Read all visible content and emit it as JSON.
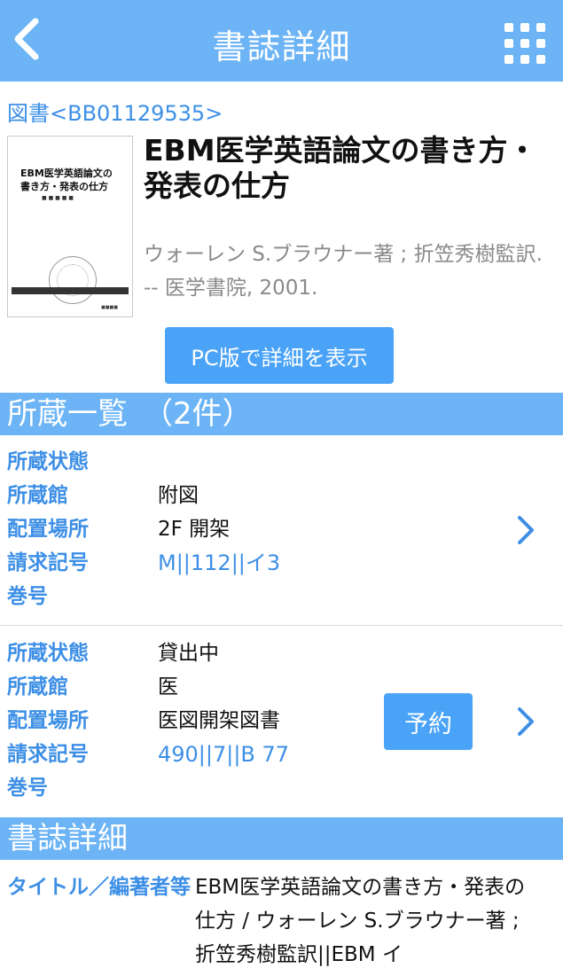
{
  "header": {
    "title": "書誌詳細"
  },
  "bib_id": "図書<BB01129535>",
  "book": {
    "cover_lines": [
      "EBM医学英語論文の",
      "書き方・発表の仕方"
    ],
    "title": "EBM医学英語論文の書き方・発表の仕方",
    "meta": "ウォーレン S.ブラウナー著 ; 折笠秀樹監訳. -- 医学書院, 2001."
  },
  "pc_button_label": "PC版で詳細を表示",
  "holdings_section": {
    "title": "所蔵一覧　（2件）"
  },
  "holdings": [
    {
      "labels": [
        "所蔵状態",
        "所蔵館",
        "配置場所",
        "請求記号",
        "巻号"
      ],
      "status": "",
      "library": "附図",
      "location": "2F 開架",
      "call_number": "M||112||イ3",
      "volume": ""
    },
    {
      "labels": [
        "所蔵状態",
        "所蔵館",
        "配置場所",
        "請求記号",
        "巻号"
      ],
      "status": "貸出中",
      "library": "医",
      "location": "医図開架図書",
      "call_number": "490||7||B 77",
      "volume": "",
      "reserve_label": "予約"
    }
  ],
  "details_section": {
    "title": "書誌詳細"
  },
  "details": {
    "label": "タイトル／編著者等",
    "value": "EBM医学英語論文の書き方・発表の仕方 / ウォーレン S.ブラウナー著 ; 折笠秀樹監訳||EBM イ"
  },
  "colors": {
    "header_bg": "#6cb4f5",
    "accent": "#3d8fe6",
    "button_bg": "#4aa3f7"
  },
  "icons": {
    "back": "chevron-left-icon",
    "menu": "grid-menu-icon",
    "row_arrow": "chevron-right-icon"
  }
}
